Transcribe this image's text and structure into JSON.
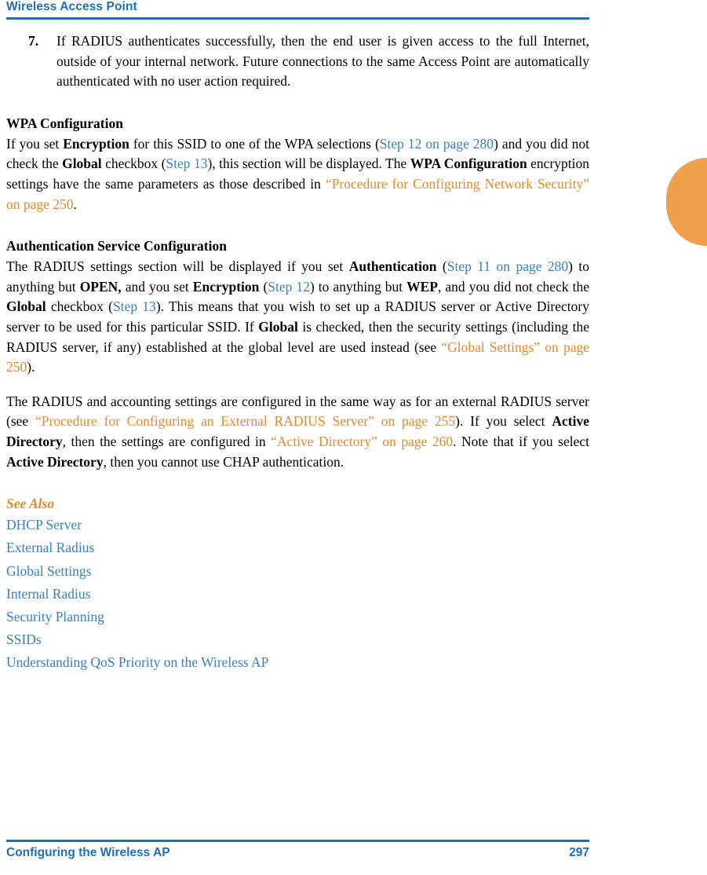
{
  "header": {
    "title": "Wireless Access Point"
  },
  "footer": {
    "chapter": "Configuring the Wireless AP",
    "page_number": "297"
  },
  "step7": {
    "number": "7.",
    "text": "If RADIUS authenticates successfully, then the end user is given access to the full Internet, outside of your internal network. Future connections to the same Access Point are automatically authenticated with no user action required."
  },
  "wpa_section": {
    "heading": "WPA Configuration",
    "t1": "If you set ",
    "b1": "Encryption",
    "t2": " for this SSID to one of the WPA selections (",
    "x1": "Step 12 on page 280",
    "t3": ") and you did not check the ",
    "b2": "Global",
    "t4": " checkbox (",
    "x2": "Step 13",
    "t5": "), this section will be displayed. The ",
    "b3": "WPA Configuration",
    "t6": " encryption settings have the same parameters as those described in ",
    "x3": "“Procedure for Configuring Network Security” on page 250",
    "t7": "."
  },
  "auth_section": {
    "heading": "Authentication Service Configuration",
    "p1": {
      "t1": "The RADIUS settings section will be displayed if you set ",
      "b1": "Authentication",
      "t2": " (",
      "x1": "Step 11 on page 280",
      "t3": ") to anything but ",
      "b2": "OPEN,",
      "t4": " and you set ",
      "b3": "Encryption",
      "t5": " (",
      "x2": "Step 12",
      "t6": ") to anything but ",
      "b4": "WEP",
      "t7": ", and you did not check the ",
      "b5": "Global",
      "t8": " checkbox (",
      "x3": "Step 13",
      "t9": "). This means that you wish to set up a RADIUS server or Active Directory server to be used for this particular SSID. If ",
      "b6": "Global",
      "t10": " is checked, then the security settings (including the RADIUS server, if any) established at the global level are used instead (see ",
      "x4": "“Global Settings” on page 250",
      "t11": ")."
    },
    "p2": {
      "t1": "The RADIUS and accounting settings are configured in the same way as for an external RADIUS server (see ",
      "x1": "“Procedure for Configuring an External RADIUS Server” on page 255",
      "t2": "). If you select ",
      "b1": "Active Directory",
      "t3": ", then the settings are configured in ",
      "x2": "“Active Directory” on page 260",
      "t4": ". Note that if you select ",
      "b2": "Active Directory",
      "t5": ", then you cannot use CHAP authentication."
    }
  },
  "see_also": {
    "heading": "See Also",
    "links": [
      "DHCP Server",
      "External Radius",
      "Global Settings",
      "Internal Radius",
      "Security Planning",
      "SSIDs",
      "Understanding QoS Priority on the Wireless AP"
    ]
  },
  "colors": {
    "accent_blue": "#1f6fb8",
    "link_blue": "#3a7fc1",
    "xref_orange": "#e08a2e",
    "tab_orange": "#f0a04b"
  }
}
